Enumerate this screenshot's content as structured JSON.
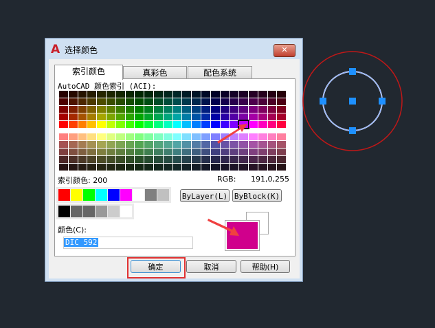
{
  "dialog": {
    "title": "选择颜色",
    "close": "✕"
  },
  "tabs": [
    {
      "label": "索引颜色",
      "active": true
    },
    {
      "label": "真彩色"
    },
    {
      "label": "配色系统"
    }
  ],
  "panel": {
    "aci_label": "AutoCAD 颜色索引 (ACI):",
    "index_label": "索引颜色: 200",
    "rgb_label": "RGB:",
    "rgb_value": "191,0,255",
    "standard_colors_row1": [
      "#ff0000",
      "#ffff00",
      "#00ff00",
      "#00ffff",
      "#0000ff",
      "#ff00ff",
      "#ffffff",
      "#808080",
      "#c0c0c0"
    ],
    "standard_colors_row2": [
      "#000000",
      "#656565",
      "#666666",
      "#999999",
      "#cccccc",
      "#ffffff"
    ],
    "bylayer": "ByLayer(L)",
    "byblock": "ByBlock(K)",
    "color_label": "颜色(C):",
    "color_value": "DIC 592",
    "new_color": "#d0008c",
    "old_color": "#ffffff"
  },
  "buttons": {
    "ok": "确定",
    "cancel": "取消",
    "help": "帮助(H)"
  },
  "accent": {
    "highlight": "#e03030",
    "selection": "#3399ff",
    "circle": "#c01818",
    "grip": "#1e90ff"
  }
}
